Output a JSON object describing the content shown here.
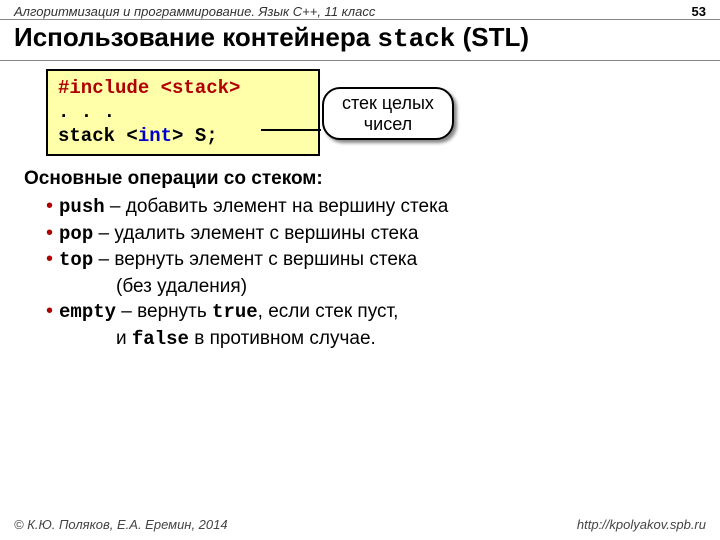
{
  "header": {
    "course": "Алгоритмизация и программирование. Язык C++, 11 класс",
    "page": "53"
  },
  "title": {
    "pre": "Использование контейнера ",
    "mono": "stack",
    "post": " (STL)"
  },
  "code": {
    "l1_a": "#include ",
    "l1_b": "<stack>",
    "l2": ". . .",
    "l3_a": "stack <",
    "l3_b": "int",
    "l3_c": "> S;"
  },
  "callout": {
    "line1": "стек целых",
    "line2": "чисел"
  },
  "ops": {
    "title": "Основные операции со стеком:",
    "items": [
      {
        "kw": "push",
        "txt": " – добавить элемент на вершину стека"
      },
      {
        "kw": "pop",
        "txt": " – удалить элемент с вершины стека"
      },
      {
        "kw": "top",
        "txt": " – вернуть элемент с вершины стека"
      }
    ],
    "top_extra": "(без удаления)",
    "empty_kw": "empty",
    "empty_t1": " – вернуть ",
    "empty_true": "true",
    "empty_t2": ", если стек пуст,",
    "empty_line2a": "и ",
    "empty_false": "false",
    "empty_line2b": " в противном случае."
  },
  "footer": {
    "left": "© К.Ю. Поляков, Е.А. Еремин, 2014",
    "right": "http://kpolyakov.spb.ru"
  }
}
